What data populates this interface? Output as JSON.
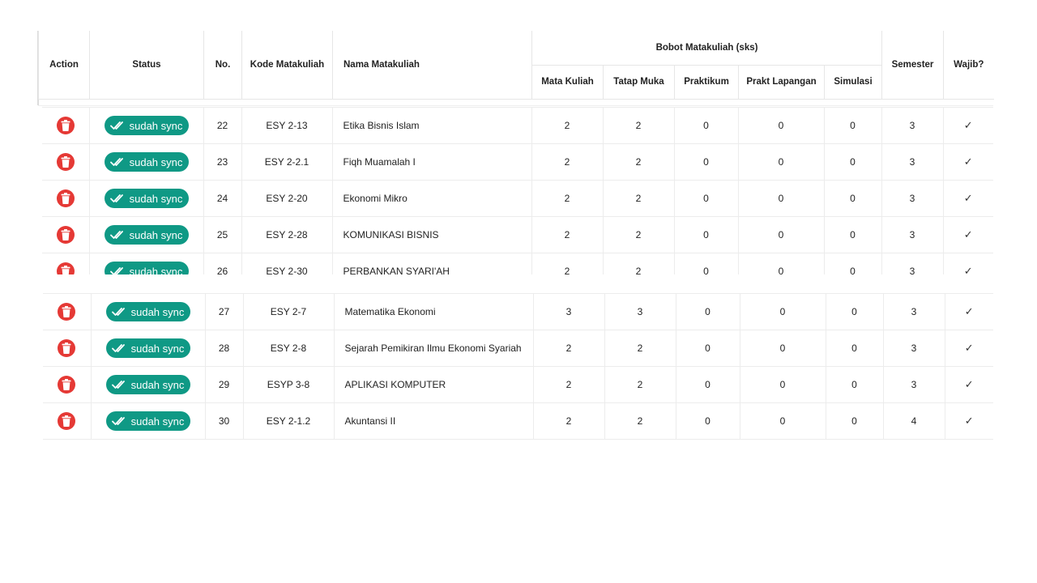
{
  "header": {
    "action": "Action",
    "status": "Status",
    "no": "No.",
    "kode": "Kode Matakuliah",
    "nama": "Nama Matakuliah",
    "bobot": "Bobot Matakuliah (sks)",
    "mata_kuliah": "Mata Kuliah",
    "tatap_muka": "Tatap Muka",
    "praktikum": "Praktikum",
    "prakt_lapangan": "Prakt Lapangan",
    "simulasi": "Simulasi",
    "semester": "Semester",
    "wajib": "Wajib?"
  },
  "icons": {
    "delete": "trash-icon",
    "sync": "double-check-icon",
    "wajib": "check-icon"
  },
  "colors": {
    "delete": "#e53935",
    "badge": "#0f9985"
  },
  "rows_top": [
    {
      "status": "sudah sync",
      "no": "22",
      "kode": "ESY 2-13",
      "nama": "Etika Bisnis Islam",
      "mata_kuliah": "2",
      "tatap_muka": "2",
      "praktikum": "0",
      "prakt_lapangan": "0",
      "simulasi": "0",
      "semester": "3",
      "wajib": "✓"
    },
    {
      "status": "sudah sync",
      "no": "23",
      "kode": "ESY 2-2.1",
      "nama": "Fiqh Muamalah I",
      "mata_kuliah": "2",
      "tatap_muka": "2",
      "praktikum": "0",
      "prakt_lapangan": "0",
      "simulasi": "0",
      "semester": "3",
      "wajib": "✓"
    },
    {
      "status": "sudah sync",
      "no": "24",
      "kode": "ESY 2-20",
      "nama": "Ekonomi Mikro",
      "mata_kuliah": "2",
      "tatap_muka": "2",
      "praktikum": "0",
      "prakt_lapangan": "0",
      "simulasi": "0",
      "semester": "3",
      "wajib": "✓"
    },
    {
      "status": "sudah sync",
      "no": "25",
      "kode": "ESY 2-28",
      "nama": "KOMUNIKASI BISNIS",
      "mata_kuliah": "2",
      "tatap_muka": "2",
      "praktikum": "0",
      "prakt_lapangan": "0",
      "simulasi": "0",
      "semester": "3",
      "wajib": "✓"
    },
    {
      "status": "sudah sync",
      "no": "26",
      "kode": "ESY 2-30",
      "nama": "PERBANKAN SYARI'AH",
      "mata_kuliah": "2",
      "tatap_muka": "2",
      "praktikum": "0",
      "prakt_lapangan": "0",
      "simulasi": "0",
      "semester": "3",
      "wajib": "✓"
    }
  ],
  "rows_bottom": [
    {
      "status": "sudah sync",
      "no": "27",
      "kode": "ESY 2-7",
      "nama": "Matematika Ekonomi",
      "mata_kuliah": "3",
      "tatap_muka": "3",
      "praktikum": "0",
      "prakt_lapangan": "0",
      "simulasi": "0",
      "semester": "3",
      "wajib": "✓"
    },
    {
      "status": "sudah sync",
      "no": "28",
      "kode": "ESY 2-8",
      "nama": "Sejarah Pemikiran Ilmu Ekonomi Syariah",
      "mata_kuliah": "2",
      "tatap_muka": "2",
      "praktikum": "0",
      "prakt_lapangan": "0",
      "simulasi": "0",
      "semester": "3",
      "wajib": "✓"
    },
    {
      "status": "sudah sync",
      "no": "29",
      "kode": "ESYP 3-8",
      "nama": "APLIKASI KOMPUTER",
      "mata_kuliah": "2",
      "tatap_muka": "2",
      "praktikum": "0",
      "prakt_lapangan": "0",
      "simulasi": "0",
      "semester": "3",
      "wajib": "✓"
    },
    {
      "status": "sudah sync",
      "no": "30",
      "kode": "ESY 2-1.2",
      "nama": "Akuntansi II",
      "mata_kuliah": "2",
      "tatap_muka": "2",
      "praktikum": "0",
      "prakt_lapangan": "0",
      "simulasi": "0",
      "semester": "4",
      "wajib": "✓"
    }
  ]
}
